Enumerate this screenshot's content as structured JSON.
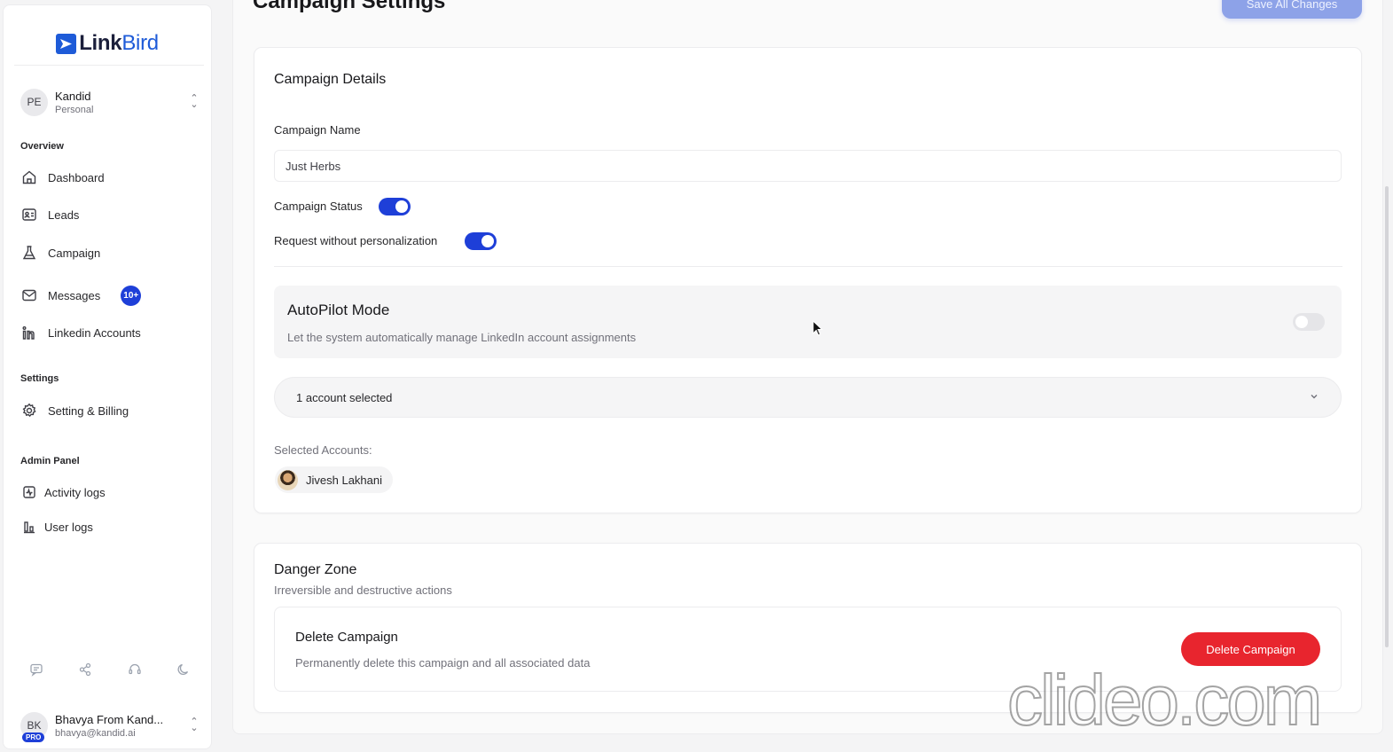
{
  "brand": {
    "name_part1": "Link",
    "name_part2": "Bird",
    "accent": "#1e5bd8"
  },
  "workspace": {
    "initials": "PE",
    "name": "Kandid",
    "type": "Personal"
  },
  "sidebar": {
    "overview_label": "Overview",
    "items": [
      {
        "label": "Dashboard",
        "icon": "home-icon"
      },
      {
        "label": "Leads",
        "icon": "contact-card-icon"
      },
      {
        "label": "Campaign",
        "icon": "flask-icon"
      },
      {
        "label": "Messages",
        "icon": "mail-icon",
        "badge": "10+"
      },
      {
        "label": "Linkedin Accounts",
        "icon": "linkedin-icon"
      }
    ],
    "settings_label": "Settings",
    "settings_items": [
      {
        "label": "Setting & Billing",
        "icon": "gear-icon"
      }
    ],
    "admin_label": "Admin Panel",
    "admin_items": [
      {
        "label": "Activity logs",
        "icon": "activity-icon"
      },
      {
        "label": "User logs",
        "icon": "bar-chart-icon"
      }
    ],
    "bottom_icons": [
      "chat-icon",
      "share-icon",
      "support-icon",
      "moon-icon"
    ]
  },
  "user": {
    "initials": "BK",
    "badge": "PRO",
    "name": "Bhavya From Kand...",
    "email": "bhavya@kandid.ai"
  },
  "header": {
    "title": "Campaign Settings",
    "save_label": "Save All Changes"
  },
  "details": {
    "title": "Campaign Details",
    "name_label": "Campaign Name",
    "name_value": "Just Herbs",
    "status_label": "Campaign Status",
    "status_on": true,
    "personalization_label": "Request without personalization",
    "personalization_on": true
  },
  "autopilot": {
    "title": "AutoPilot Mode",
    "description": "Let the system automatically manage LinkedIn account assignments",
    "enabled": false
  },
  "accounts": {
    "select_value": "1 account selected",
    "selected_label": "Selected Accounts:",
    "chips": [
      "Jivesh Lakhani"
    ]
  },
  "danger": {
    "title": "Danger Zone",
    "subtitle": "Irreversible and destructive actions",
    "delete_title": "Delete Campaign",
    "delete_desc": "Permanently delete this campaign and all associated data",
    "delete_button": "Delete Campaign",
    "color": "#e8252e"
  },
  "watermark": "clideo.com"
}
